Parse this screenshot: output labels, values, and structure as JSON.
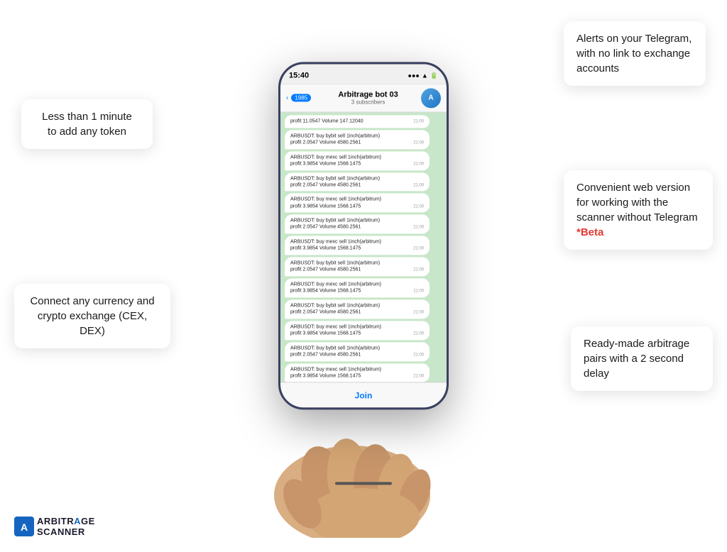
{
  "page": {
    "background": "#ffffff"
  },
  "phone": {
    "status_bar": {
      "time": "15:40",
      "icons": "●●●"
    },
    "header": {
      "back_count": "1985",
      "chat_name": "Arbitrage bot 03",
      "chat_subtitle": "3 subscribers",
      "avatar_letter": "A"
    },
    "messages": [
      {
        "text": "profit 11.0547 Volume 147.12040",
        "time": "21:00"
      },
      {
        "text": "ARBUSDT: buy bybit  sell 1inch(arbitrum)\nprofit 2.0547 Volume 4580.2561",
        "time": "21:00"
      },
      {
        "text": "ARBUSDT: buy mexc  sell 1inch(arbitrum)\nprofit 3.9854 Volume 1568.1475",
        "time": "21:00"
      },
      {
        "text": "ARBUSDT: buy bybit  sell 1inch(arbitrum)\nprofit 2.0547 Volume 4580.2561",
        "time": "21:00"
      },
      {
        "text": "ARBUSDT: buy mexc  sell 1inch(arbitrum)\nprofit 3.9854 Volume 1568.1475",
        "time": "21:00"
      },
      {
        "text": "ARBUSDT: buy bybit  sell 1inch(arbitrum)\nprofit 2.0547 Volume 4580.2561",
        "time": "21:00"
      },
      {
        "text": "ARBUSDT: buy mexc  sell 1inch(arbitrum)\nprofit 3.9854 Volume 1568.1475",
        "time": "21:00"
      },
      {
        "text": "ARBUSDT: buy bybit  sell 1inch(arbitrum)\nprofit 2.0547 Volume 4580.2561",
        "time": "21:00"
      },
      {
        "text": "ARBUSDT: buy mexc  sell 1inch(arbitrum)\nprofit 3.9854 Volume 1568.1475",
        "time": "21:00"
      },
      {
        "text": "ARBUSDT: buy bybit  sell 1inch(arbitrum)\nprofit 2.0547 Volume 4580.2561",
        "time": "21:00"
      },
      {
        "text": "ARBUSDT: buy mexc  sell 1inch(arbitrum)\nprofit 3.9854 Volume 1568.1475",
        "time": "21:00"
      },
      {
        "text": "ARBUSDT: buy bybit  sell 1inch(arbitrum)\nprofit 2.0547 Volume 4580.2561",
        "time": "21:00"
      },
      {
        "text": "ARBUSDT: buy mexc  sell 1inch(arbitrum)\nprofit 3.9854 Volume 1568.1475",
        "time": "21:00"
      }
    ],
    "join_button": "Join"
  },
  "callouts": {
    "top_right": "Alerts on your Telegram, with no link to exchange accounts",
    "top_left_line1": "Less than 1 minute",
    "top_left_line2": "to add any token",
    "mid_right_line1": "Convenient web version for working with the scanner without Telegram",
    "mid_right_beta": "*Beta",
    "bot_left_line1": "Connect any currency and crypto exchange (CEX, DEX)",
    "bot_right_line1": "Ready-made arbitrage pairs with a 2 second delay"
  },
  "logo": {
    "line1": "ARBITR",
    "line1_highlight": "A",
    "line2": "GE",
    "line3": "SCANNER"
  }
}
